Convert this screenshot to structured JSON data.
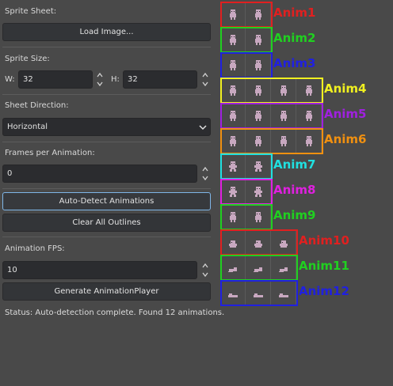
{
  "panel": {
    "sprite_sheet_label": "Sprite Sheet:",
    "load_image_button": "Load Image...",
    "sprite_size_label": "Sprite Size:",
    "width_label": "W:",
    "width_value": "32",
    "height_label": "H:",
    "height_value": "32",
    "sheet_direction_label": "Sheet Direction:",
    "sheet_direction_value": "Horizontal",
    "frames_label": "Frames per Animation:",
    "frames_value": "0",
    "auto_detect_button": "Auto-Detect Animations",
    "clear_outlines_button": "Clear All Outlines",
    "fps_label": "Animation FPS:",
    "fps_value": "10",
    "generate_button": "Generate AnimationPlayer",
    "status": "Status: Auto-detection complete. Found 12 animations."
  },
  "animations": [
    {
      "name": "Anim1",
      "frames": 2,
      "color": "#e02020",
      "pose": "stand"
    },
    {
      "name": "Anim2",
      "frames": 2,
      "color": "#20d020",
      "pose": "stand"
    },
    {
      "name": "Anim3",
      "frames": 2,
      "color": "#2020e0",
      "pose": "stand"
    },
    {
      "name": "Anim4",
      "frames": 4,
      "color": "#f0f020",
      "pose": "walk"
    },
    {
      "name": "Anim5",
      "frames": 4,
      "color": "#a020e0",
      "pose": "walk"
    },
    {
      "name": "Anim6",
      "frames": 4,
      "color": "#f09010",
      "pose": "walk"
    },
    {
      "name": "Anim7",
      "frames": 2,
      "color": "#20e0e0",
      "pose": "arms"
    },
    {
      "name": "Anim8",
      "frames": 2,
      "color": "#e020e0",
      "pose": "arms"
    },
    {
      "name": "Anim9",
      "frames": 2,
      "color": "#20d020",
      "pose": "stand"
    },
    {
      "name": "Anim10",
      "frames": 3,
      "color": "#e02020",
      "pose": "crouch"
    },
    {
      "name": "Anim11",
      "frames": 3,
      "color": "#20d020",
      "pose": "slide"
    },
    {
      "name": "Anim12",
      "frames": 3,
      "color": "#2020e0",
      "pose": "lie"
    }
  ],
  "colors": {
    "focus_border": "#7fb6e8",
    "panel_bg": "#494949",
    "sprite": "#c8a8c0"
  },
  "icons": [
    "chevron-down-icon",
    "spin-up-icon",
    "spin-down-icon",
    "sprite-icon"
  ]
}
